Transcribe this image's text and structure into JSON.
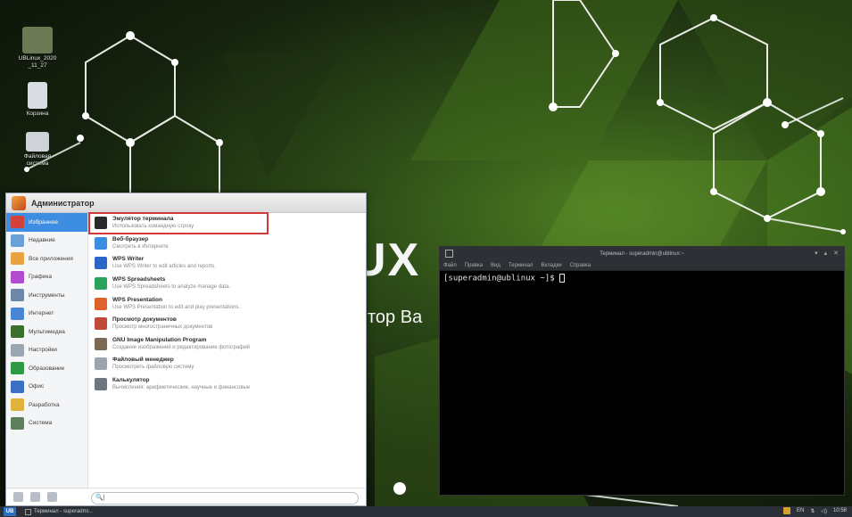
{
  "desktop": {
    "icons": [
      {
        "name": "desktop-icon-ublinux-folder",
        "label": "UBLinux_2020\n_11_27",
        "color": "#6b7a54"
      },
      {
        "name": "desktop-icon-trash",
        "label": "Корзина",
        "color": "#d9dde2"
      },
      {
        "name": "desktop-icon-filesystem",
        "label": "Файловая\nсистема",
        "color": "#cfd3d7"
      }
    ],
    "wall_text_1": "UX",
    "wall_text_2": "тор Ba"
  },
  "menu": {
    "user_name": "Администратор",
    "categories": [
      {
        "label": "Избранное",
        "color": "#d3423a",
        "active": true
      },
      {
        "label": "Недавние",
        "color": "#6aa0d8",
        "active": false
      },
      {
        "label": "Все приложения",
        "color": "#e8a23f",
        "active": false
      },
      {
        "label": "Графика",
        "color": "#b14bd0",
        "active": false
      },
      {
        "label": "Инструменты",
        "color": "#6c87a8",
        "active": false
      },
      {
        "label": "Интернет",
        "color": "#4b86d6",
        "active": false
      },
      {
        "label": "Мультимедиа",
        "color": "#3d6f2c",
        "active": false
      },
      {
        "label": "Настройки",
        "color": "#9aa7b3",
        "active": false
      },
      {
        "label": "Образование",
        "color": "#2f9a43",
        "active": false
      },
      {
        "label": "Офис",
        "color": "#3a6fc4",
        "active": false
      },
      {
        "label": "Разработка",
        "color": "#e1b23a",
        "active": false
      },
      {
        "label": "Система",
        "color": "#5d7f5e",
        "active": false
      }
    ],
    "apps": [
      {
        "name": "Эмулятор терминала",
        "desc": "Использовать командную строку",
        "color": "#2a2a2a",
        "highlight": true
      },
      {
        "name": "Веб-браузер",
        "desc": "Смотреть в Интернете",
        "color": "#3d8ee2",
        "highlight": false
      },
      {
        "name": "WPS Writer",
        "desc": "Use WPS Writer to edit articles and reports.",
        "color": "#2c64c8",
        "highlight": false
      },
      {
        "name": "WPS Spreadsheets",
        "desc": "Use WPS Spreadsheets to analyze manage data.",
        "color": "#2aa45a",
        "highlight": false
      },
      {
        "name": "WPS Presentation",
        "desc": "Use WPS Presentation to edit and play presentations.",
        "color": "#e0622b",
        "highlight": false
      },
      {
        "name": "Просмотр документов",
        "desc": "Просмотр многостраничных документов",
        "color": "#c24a38",
        "highlight": false
      },
      {
        "name": "GNU Image Manipulation Program",
        "desc": "Создание изображений и редактирование фотографий",
        "color": "#7d6a52",
        "highlight": false
      },
      {
        "name": "Файловый менеджер",
        "desc": "Просмотреть файловую систему",
        "color": "#9aa4ae",
        "highlight": false
      },
      {
        "name": "Калькулятор",
        "desc": "Вычисления: арифметические, научные и финансовые",
        "color": "#6d7780",
        "highlight": false
      }
    ],
    "search_placeholder": "🔍|"
  },
  "terminal": {
    "title": "Терминал - superadmin@ublinux:~",
    "menu_items": [
      "Файл",
      "Правка",
      "Вид",
      "Терминал",
      "Вкладки",
      "Справка"
    ],
    "prompt": "[superadmin@ublinux ~]$ "
  },
  "taskbar": {
    "start_label": "UB",
    "task_label": "Терминал - superadmi...",
    "lang": "EN",
    "time": "10:58"
  }
}
